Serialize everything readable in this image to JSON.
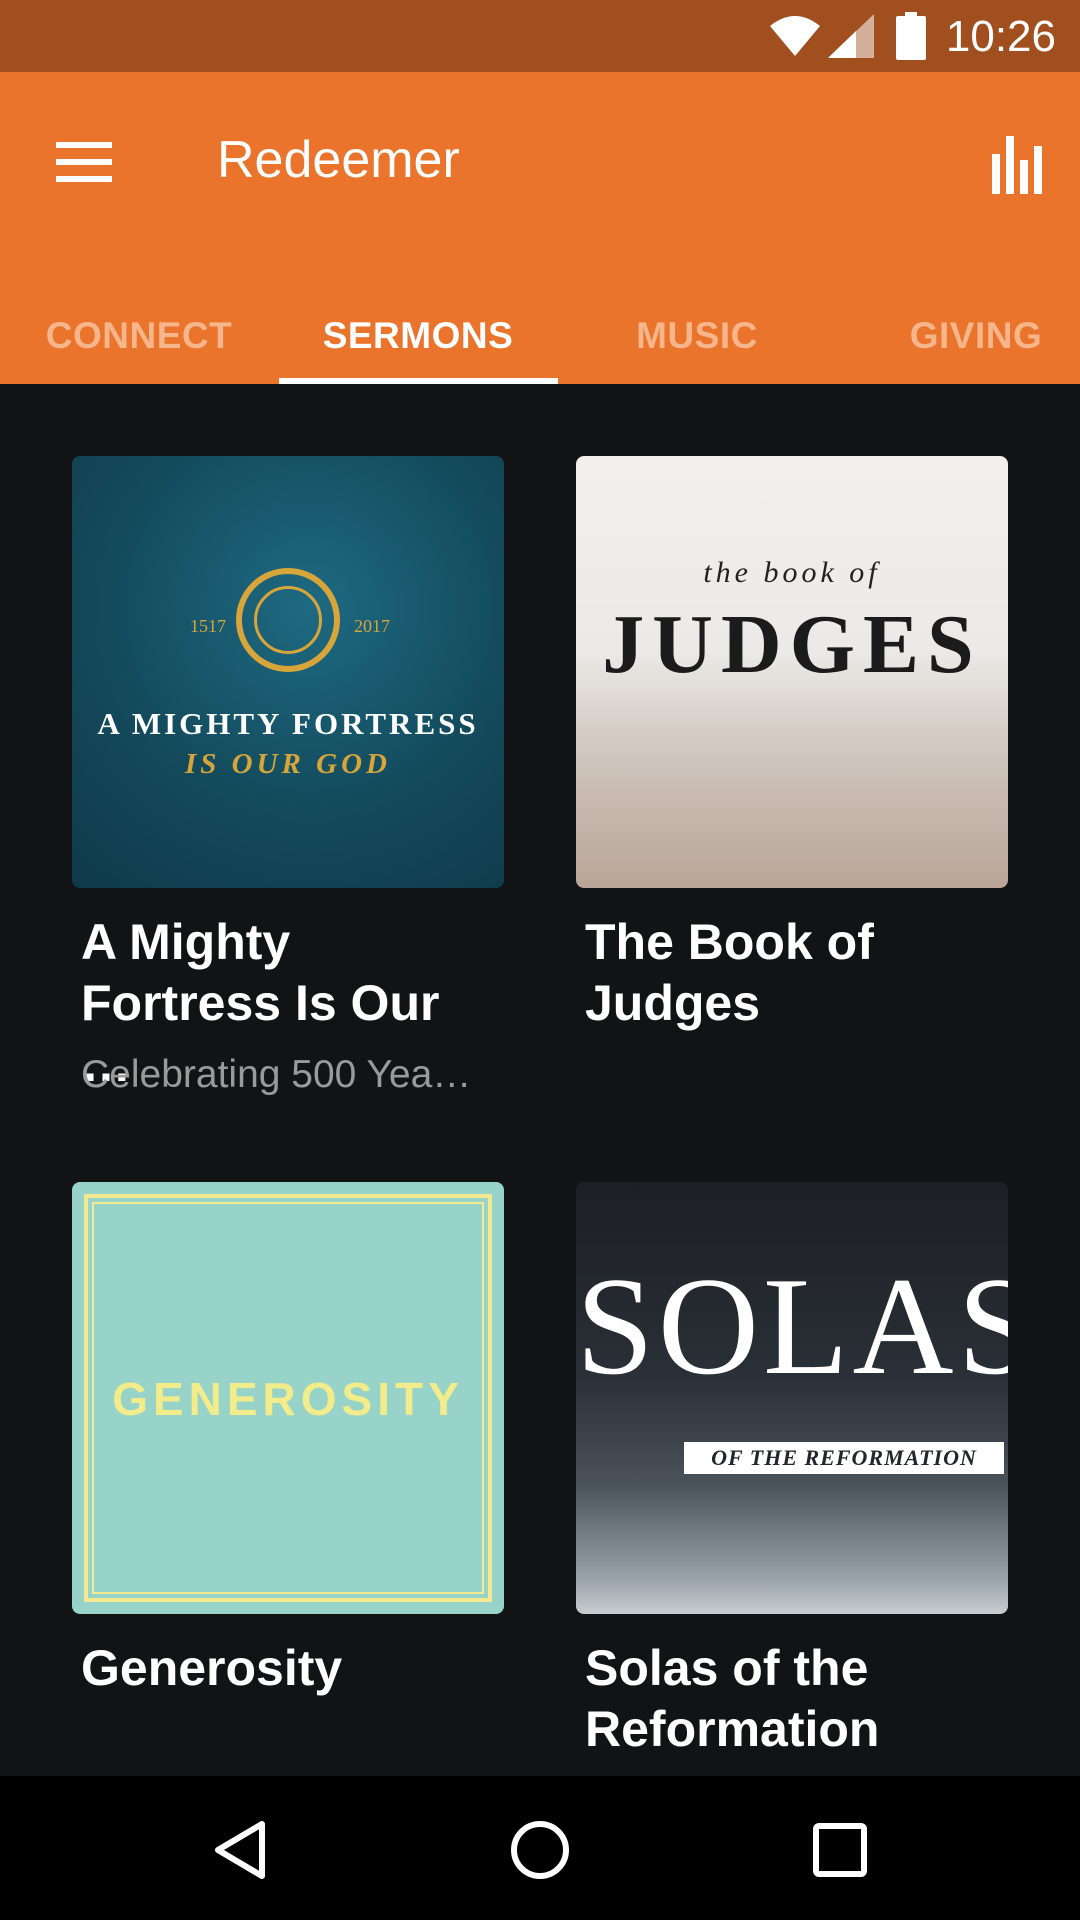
{
  "status_bar": {
    "time": "10:26",
    "icons": [
      "wifi-icon",
      "signal-icon",
      "battery-icon"
    ]
  },
  "app_bar": {
    "title": "Redeemer",
    "menu_icon": "hamburger-menu-icon",
    "action_icon": "bar-chart-icon",
    "background_color": "#ea742b"
  },
  "tabs": [
    {
      "label": "CONNECT",
      "active": false
    },
    {
      "label": "SERMONS",
      "active": true
    },
    {
      "label": "MUSIC",
      "active": false
    },
    {
      "label": "GIVING",
      "active": false
    }
  ],
  "sermon_series": [
    {
      "title": "A Mighty Fortress Is Our …",
      "subtitle": "Celebrating 500 Yea…",
      "artwork": {
        "year_left": "1517",
        "year_right": "2017",
        "line1": "A MIGHTY FORTRESS",
        "line2": "IS OUR GOD"
      }
    },
    {
      "title": "The Book of Judges",
      "artwork": {
        "line1": "the book of",
        "line2": "JUDGES"
      }
    },
    {
      "title": "Generosity",
      "artwork": {
        "line1": "GENEROSITY"
      }
    },
    {
      "title": "Solas of the Reformation",
      "artwork": {
        "line1": "SOLAS",
        "line2": "OF THE REFORMATION"
      }
    }
  ],
  "nav_bar": {
    "icons": [
      "back-icon",
      "home-icon",
      "recents-icon"
    ]
  }
}
